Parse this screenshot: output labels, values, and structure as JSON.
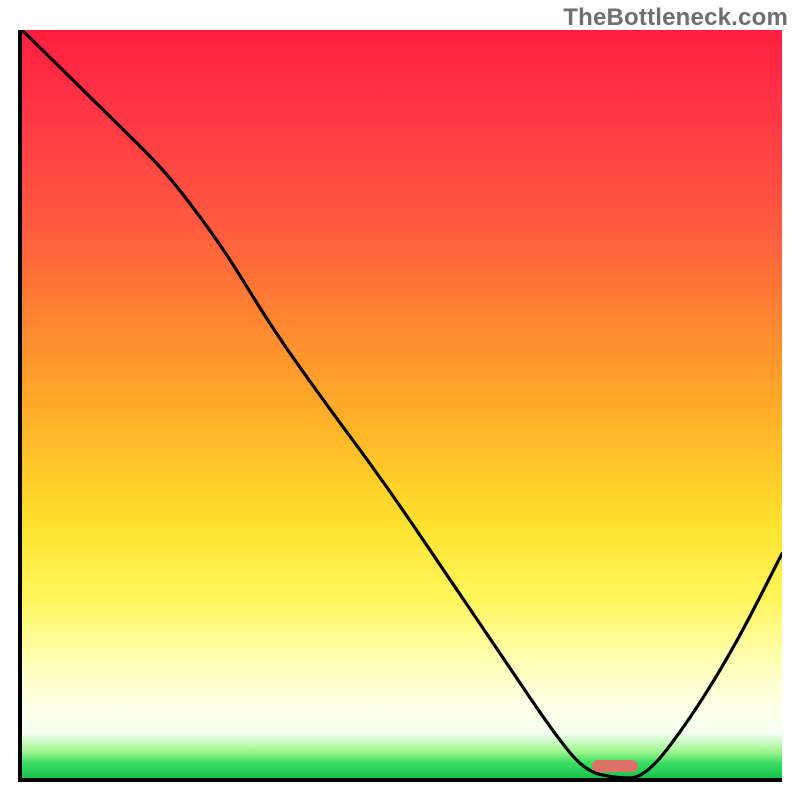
{
  "watermark": "TheBottleneck.com",
  "colors": {
    "curve": "#000000",
    "marker": "#e0706a",
    "axis": "#000000"
  },
  "chart_data": {
    "type": "line",
    "title": "",
    "xlabel": "",
    "ylabel": "",
    "xlim": [
      0,
      100
    ],
    "ylim": [
      0,
      100
    ],
    "series": [
      {
        "name": "bottleneck-curve",
        "x": [
          0,
          6,
          12,
          18,
          22,
          27,
          33,
          40,
          48,
          56,
          64,
          70,
          74,
          78,
          82,
          88,
          94,
          100
        ],
        "y": [
          100,
          94,
          88,
          82,
          77,
          70,
          60,
          50,
          39,
          27,
          15,
          6,
          1,
          0,
          0,
          8,
          18,
          30
        ]
      }
    ],
    "marker": {
      "x_center": 78,
      "width_pct": 6,
      "y": 0.5
    },
    "gradient_stops": [
      {
        "pct": 0,
        "color": "#ff1f3e"
      },
      {
        "pct": 26,
        "color": "#ff5a3f"
      },
      {
        "pct": 54,
        "color": "#ffb727"
      },
      {
        "pct": 76,
        "color": "#fff65c"
      },
      {
        "pct": 94,
        "color": "#f4fff0"
      },
      {
        "pct": 100,
        "color": "#17c24d"
      }
    ]
  }
}
